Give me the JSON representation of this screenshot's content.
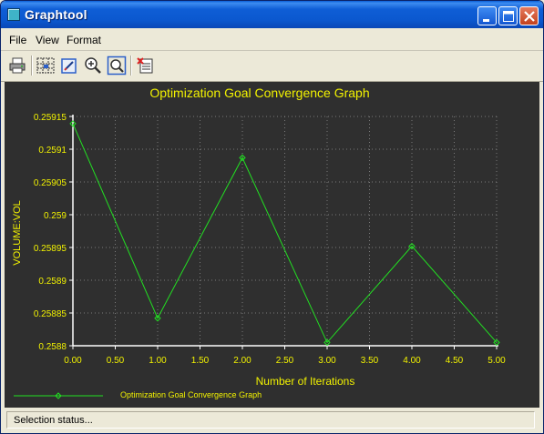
{
  "window": {
    "title": "Graphtool"
  },
  "menu": {
    "items": [
      "File",
      "View",
      "Format"
    ]
  },
  "toolbar": {
    "icons": [
      "print-icon",
      "grid-icon",
      "edit-icon",
      "zoom-in-icon",
      "zoom-fit-icon",
      "export-icon"
    ]
  },
  "colors": {
    "chart_background": "#2f2f2f",
    "text": "#f2f200",
    "series": "#22e022",
    "grid": "#7a7a7a"
  },
  "status": {
    "text": "Selection status..."
  },
  "chart_data": {
    "type": "line",
    "title": "Optimization Goal Convergence Graph",
    "xlabel": "Number of Iterations",
    "ylabel": "VOLUME:VOL",
    "xlim": [
      0,
      5
    ],
    "ylim": [
      0.2588,
      0.25915
    ],
    "x_ticks": [
      "0.00",
      "0.50",
      "1.00",
      "1.50",
      "2.00",
      "2.50",
      "3.00",
      "3.50",
      "4.00",
      "4.50",
      "5.00"
    ],
    "y_ticks": [
      "0.2588",
      "0.25885",
      "0.2589",
      "0.25895",
      "0.259",
      "0.25905",
      "0.2591",
      "0.25915"
    ],
    "grid": true,
    "legend_position": "bottom-left",
    "series": [
      {
        "name": "Optimization Goal Convergence Graph",
        "x": [
          0,
          1,
          2,
          3,
          4,
          5
        ],
        "y": [
          0.259139,
          0.258842,
          0.259087,
          0.258805,
          0.258952,
          0.258805
        ]
      }
    ]
  }
}
